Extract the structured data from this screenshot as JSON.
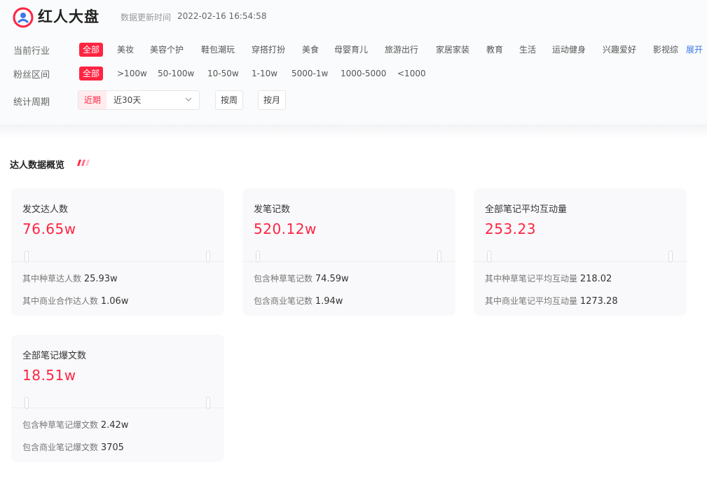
{
  "app": {
    "title": "红人大盘",
    "update_label": "数据更新时间",
    "update_time": "2022-02-16 16:54:58"
  },
  "filters": {
    "industry": {
      "label": "当前行业",
      "options": [
        "全部",
        "美妆",
        "美容个护",
        "鞋包潮玩",
        "穿搭打扮",
        "美食",
        "母婴育儿",
        "旅游出行",
        "家居家装",
        "教育",
        "生活",
        "运动健身",
        "兴趣爱好",
        "影视综"
      ],
      "expand": "展开"
    },
    "fans": {
      "label": "粉丝区间",
      "options": [
        "全部",
        ">100w",
        "50-100w",
        "10-50w",
        "1-10w",
        "5000-1w",
        "1000-5000",
        "<1000"
      ]
    },
    "period": {
      "label": "统计周期",
      "recent": "近期",
      "selected": "近30天",
      "weekly": "按周",
      "monthly": "按月"
    }
  },
  "section": {
    "title": "达人数据概览"
  },
  "cards": [
    {
      "label": "发文达人数",
      "value": "76.65w",
      "sub": [
        {
          "label": "其中种草达人数",
          "value": "25.93w"
        },
        {
          "label": "其中商业合作达人数",
          "value": "1.06w"
        }
      ]
    },
    {
      "label": "发笔记数",
      "value": "520.12w",
      "sub": [
        {
          "label": "包含种草笔记数",
          "value": "74.59w"
        },
        {
          "label": "包含商业笔记数",
          "value": "1.94w"
        }
      ]
    },
    {
      "label": "全部笔记平均互动量",
      "value": "253.23",
      "sub": [
        {
          "label": "其中种草笔记平均互动量",
          "value": "218.02"
        },
        {
          "label": "其中商业笔记平均互动量",
          "value": "1273.28"
        }
      ]
    },
    {
      "label": "全部笔记爆文数",
      "value": "18.51w",
      "sub": [
        {
          "label": "包含种草笔记爆文数",
          "value": "2.42w"
        },
        {
          "label": "包含商业笔记爆文数",
          "value": "3705"
        }
      ]
    }
  ],
  "colors": {
    "accent": "#ff2442",
    "link": "#3b77e8"
  },
  "icons": {
    "logo": "person-badge-icon",
    "chevron": "chevron-down-icon",
    "deco": "title-stripes-icon"
  }
}
